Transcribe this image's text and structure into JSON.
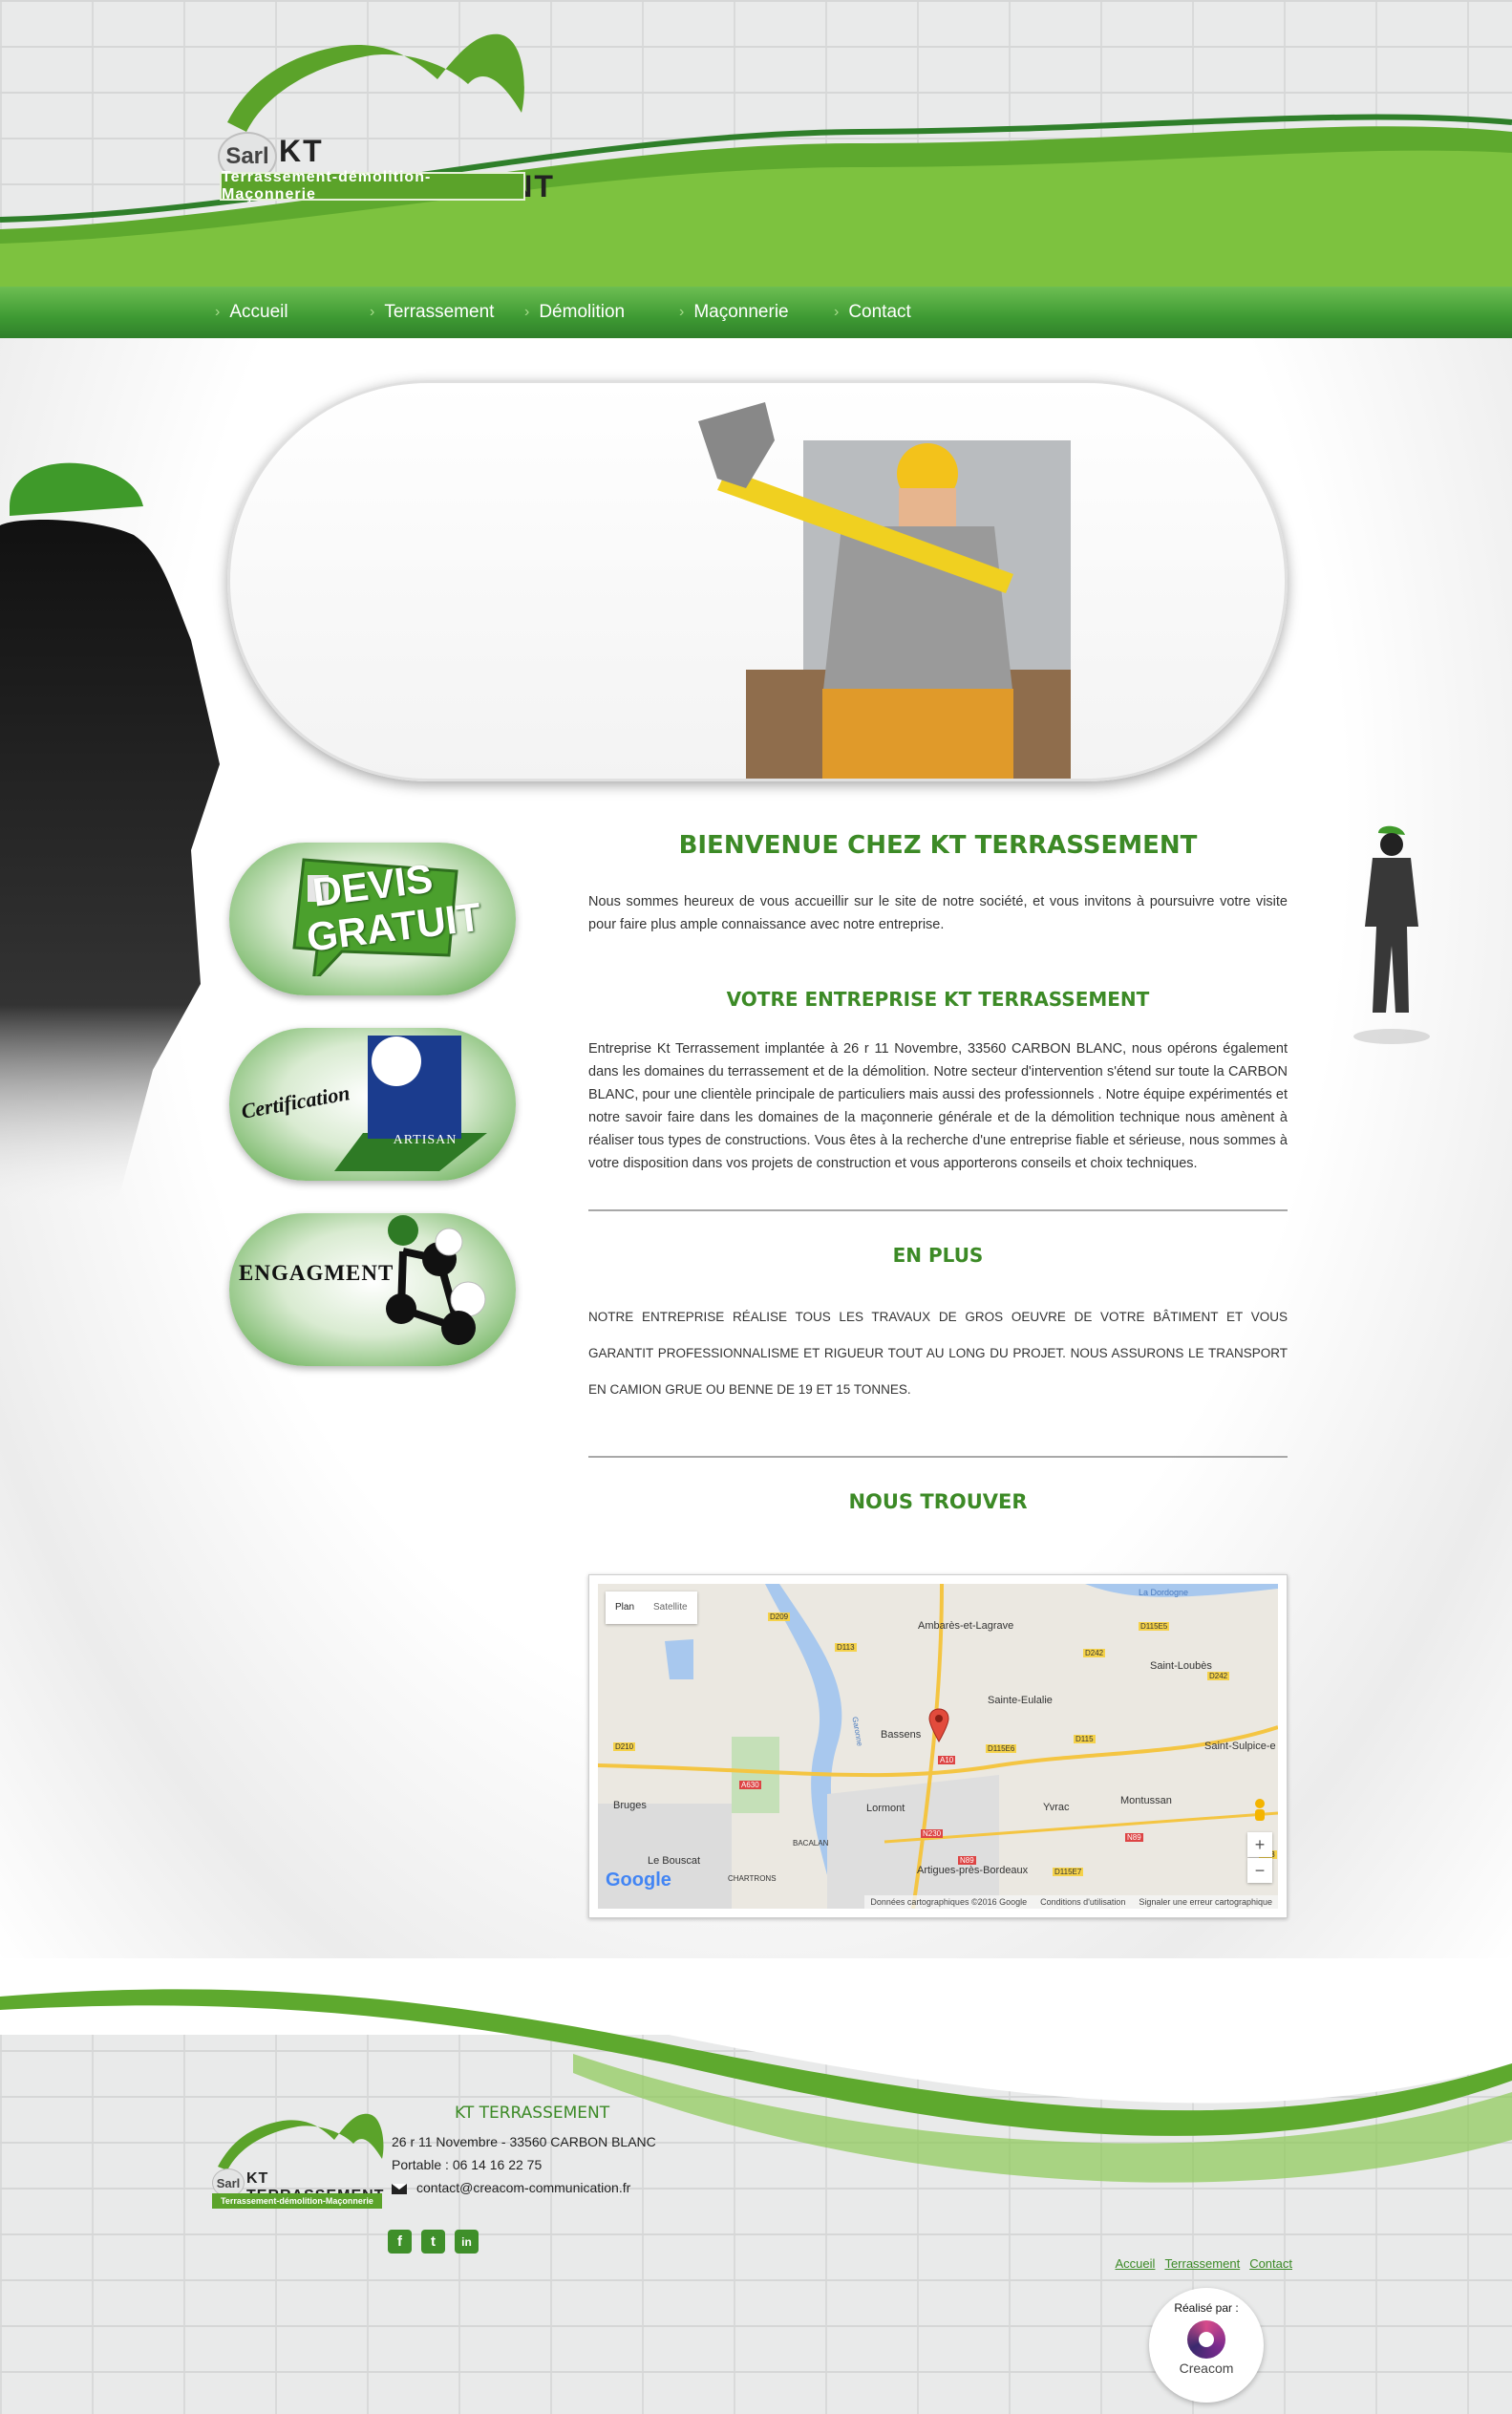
{
  "logo": {
    "sarl": "Sarl",
    "name": "KT TERRASSEMENT",
    "tagline": "Terrassement-démolition-Maçonnerie"
  },
  "nav": {
    "items": [
      {
        "label": "Accueil"
      },
      {
        "label": "Terrassement"
      },
      {
        "label": "Démolition"
      },
      {
        "label": "Maçonnerie"
      },
      {
        "label": "Contact"
      }
    ]
  },
  "badges": {
    "devis": "DEVIS GRATUIT",
    "certification": "Certification",
    "artisan": "ARTISAN",
    "engagement": "ENGAGMENT"
  },
  "content": {
    "welcome_title": "BIENVENUE CHEZ KT TERRASSEMENT",
    "intro": "Nous sommes heureux de vous accueillir sur le site de notre société, et vous invitons à poursuivre votre visite pour faire plus ample connaissance avec notre entreprise.",
    "entreprise_title": "VOTRE ENTREPRISE KT TERRASSEMENT",
    "entreprise_text": "Entreprise Kt Terrassement implantée à 26 r 11 Novembre, 33560 CARBON BLANC, nous opérons également dans les domaines du terrassement et  de la démolition. Notre secteur d'intervention s'étend sur toute la CARBON BLANC, pour une clientèle principale de particuliers mais aussi des professionnels . Notre équipe expérimentés et notre savoir faire dans les domaines de la maçonnerie générale et de la démolition technique nous amènent à réaliser tous types de constructions. Vous êtes à la recherche d'une entreprise fiable et sérieuse, nous sommes à votre disposition dans vos projets de construction et vous apporterons conseils et choix techniques.",
    "plus_title": "EN  PLUS",
    "plus_text": "Notre entreprise réalise tous les travaux de gros oeuvre de votre bâtiment et vous garantit professionnalisme et rigueur tout au long du projet. Nous assurons le transport en camion grue ou benne de 19 et 15 tonnes.",
    "find_title": "NOUS TROUVER"
  },
  "map": {
    "plan_label": "Plan",
    "satellite_label": "Satellite",
    "places": [
      "Ambarès-et-Lagrave",
      "Saint-Loubès",
      "Sainte-Eulalie",
      "Bassens",
      "Saint-Sulpice-e",
      "Bruges",
      "Lormont",
      "Yvrac",
      "Montussan",
      "Le Bouscat",
      "Artigues-près-Bordeaux",
      "BACALAN",
      "CHARTRONS",
      "La Dordogne",
      "Garonne"
    ],
    "roads": [
      "D209",
      "D113",
      "D115E5",
      "D242",
      "D242",
      "D210",
      "D115E6",
      "D115",
      "A630",
      "A10",
      "N230",
      "N89",
      "N89",
      "D115E7",
      "D13"
    ],
    "attribution": "Données cartographiques ©2016 Google",
    "terms": "Conditions d'utilisation",
    "report": "Signaler une erreur cartographique",
    "google": "Google",
    "zoom_in": "+",
    "zoom_out": "−"
  },
  "footer": {
    "logo_sarl": "Sarl",
    "logo_name": "KT TERRASSEMENT",
    "logo_tagline": "Terrassement-démolition-Maçonnerie",
    "company": "KT TERRASSEMENT",
    "address": "26 r 11 Novembre - 33560 CARBON BLANC",
    "phone": "Portable : 06 14 16 22 75",
    "email": "contact@creacom-communication.fr",
    "social": [
      "f",
      "t",
      "in"
    ],
    "links": [
      "Accueil",
      "Terrassement",
      "Contact"
    ],
    "realise_label": "Réalisé par :",
    "realise_brand": "Creacom"
  },
  "colors": {
    "brand_green": "#5ba32a",
    "nav_green": "#3e9a33",
    "title_green": "#3c8a26"
  }
}
